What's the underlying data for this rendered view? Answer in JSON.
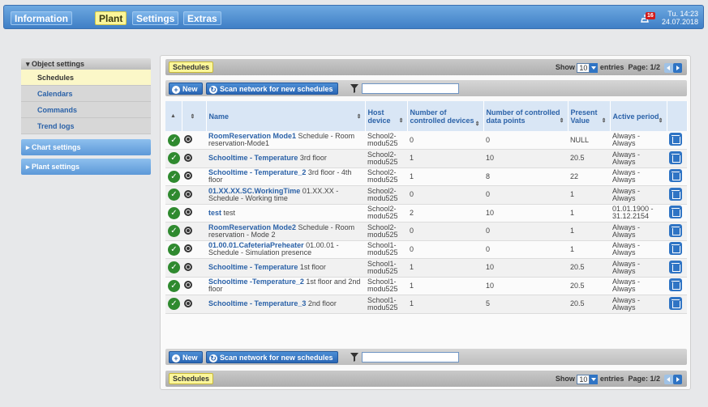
{
  "nav": {
    "tabs": [
      {
        "label": "Information"
      },
      {
        "label": "Plant"
      },
      {
        "label": "Settings"
      },
      {
        "label": "Extras"
      }
    ],
    "alarm_count": "16",
    "clock_time": "Tu. 14:23",
    "clock_date": "24.07.2018"
  },
  "sidebar": {
    "header": "Object settings",
    "items": [
      {
        "label": "Schedules"
      },
      {
        "label": "Calendars"
      },
      {
        "label": "Commands"
      },
      {
        "label": "Trend logs"
      }
    ],
    "sections": [
      {
        "label": "Chart settings"
      },
      {
        "label": "Plant settings"
      }
    ]
  },
  "panel": {
    "title": "Schedules",
    "show_label": "Show",
    "entries_value": "10",
    "entries_label": "entries",
    "page_label": "Page: 1/2",
    "new_label": "New",
    "scan_label": "Scan network for new schedules",
    "search_placeholder": ""
  },
  "table": {
    "headers": {
      "name": "Name",
      "host": "Host device",
      "controlled_devices": "Number of controlled devices",
      "controlled_points": "Number of controlled data points",
      "present": "Present Value",
      "period": "Active period"
    },
    "rows": [
      {
        "name": "RoomReservation Mode1",
        "desc": "Schedule - Room reservation-Mode1",
        "host": "School2-modu525",
        "devices": "0",
        "points": "0",
        "present": "NULL",
        "period": "Always - Always"
      },
      {
        "name": "Schooltime - Temperature",
        "desc": "3rd floor",
        "host": "School2-modu525",
        "devices": "1",
        "points": "10",
        "present": "20.5",
        "period": "Always - Always"
      },
      {
        "name": "Schooltime - Temperature_2",
        "desc": "3rd floor - 4th floor",
        "host": "School2-modu525",
        "devices": "1",
        "points": "8",
        "present": "22",
        "period": "Always - Always"
      },
      {
        "name": "01.XX.XX.SC.WorkingTime",
        "desc": "01.XX.XX - Schedule - Working time",
        "host": "School2-modu525",
        "devices": "0",
        "points": "0",
        "present": "1",
        "period": "Always - Always"
      },
      {
        "name": "test",
        "desc": "test",
        "host": "School2-modu525",
        "devices": "2",
        "points": "10",
        "present": "1",
        "period": "01.01.1900 - 31.12.2154"
      },
      {
        "name": "RoomReservation Mode2",
        "desc": "Schedule - Room reservation - Mode 2",
        "host": "School2-modu525",
        "devices": "0",
        "points": "0",
        "present": "1",
        "period": "Always - Always"
      },
      {
        "name": "01.00.01.CafeteriaPreheater",
        "desc": "01.00.01 - Schedule - Simulation presence",
        "host": "School1-modu525",
        "devices": "0",
        "points": "0",
        "present": "1",
        "period": "Always - Always"
      },
      {
        "name": "Schooltime - Temperature",
        "desc": "1st floor",
        "host": "School1-modu525",
        "devices": "1",
        "points": "10",
        "present": "20.5",
        "period": "Always - Always"
      },
      {
        "name": "Schooltime -Temperature_2",
        "desc": "1st floor and 2nd floor",
        "host": "School1-modu525",
        "devices": "1",
        "points": "10",
        "present": "20.5",
        "period": "Always - Always"
      },
      {
        "name": "Schooltime - Temperature_3",
        "desc": "2nd floor",
        "host": "School1-modu525",
        "devices": "1",
        "points": "5",
        "present": "20.5",
        "period": "Always - Always"
      }
    ]
  }
}
